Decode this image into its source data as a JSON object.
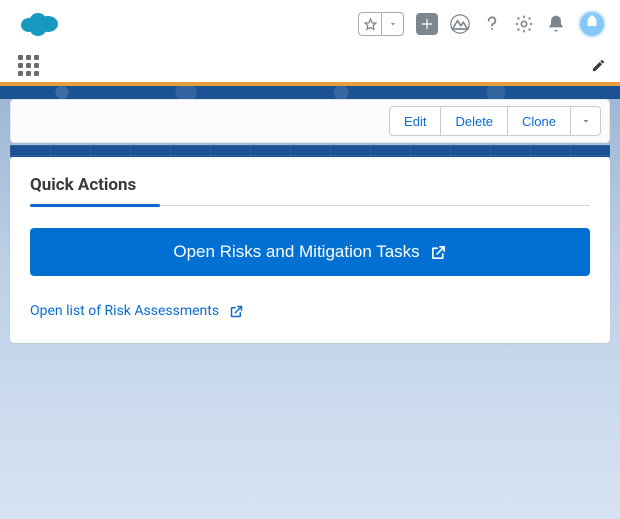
{
  "actions": {
    "edit": "Edit",
    "delete": "Delete",
    "clone": "Clone"
  },
  "card": {
    "title": "Quick Actions",
    "primary_button": "Open Risks and Mitigation Tasks",
    "secondary_link": "Open list of Risk Assessments"
  },
  "colors": {
    "brand_blue": "#0070d2",
    "dark_blue": "#1b5294",
    "orange": "#e79e3c",
    "link": "#0b6bd1"
  }
}
